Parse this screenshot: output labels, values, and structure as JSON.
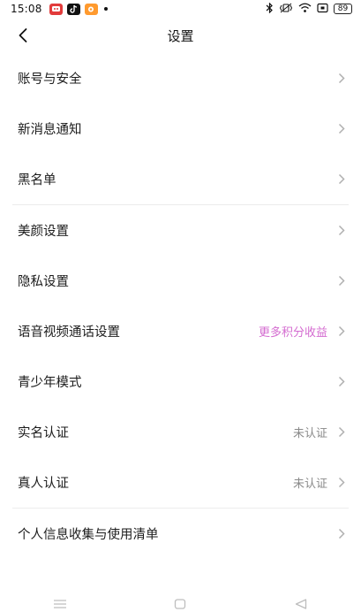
{
  "status_bar": {
    "time": "15:08",
    "battery": "89",
    "app_colors": {
      "red": "#e23b3b",
      "black": "#111111",
      "orange": "#ff9a2e"
    }
  },
  "header": {
    "title": "设置",
    "back_icon": "chevron-left-icon"
  },
  "groups": [
    [
      {
        "id": "account",
        "label": "账号与安全",
        "value": ""
      },
      {
        "id": "notify",
        "label": "新消息通知",
        "value": ""
      },
      {
        "id": "blacklist",
        "label": "黑名单",
        "value": ""
      }
    ],
    [
      {
        "id": "beauty",
        "label": "美颜设置",
        "value": ""
      },
      {
        "id": "privacy",
        "label": "隐私设置",
        "value": ""
      },
      {
        "id": "call",
        "label": "语音视频通话设置",
        "value": "更多积分收益",
        "value_color": "#d46bd0"
      },
      {
        "id": "teen",
        "label": "青少年模式",
        "value": ""
      },
      {
        "id": "realname",
        "label": "实名认证",
        "value": "未认证"
      },
      {
        "id": "realperson",
        "label": "真人认证",
        "value": "未认证"
      }
    ],
    [
      {
        "id": "personal-info",
        "label": "个人信息收集与使用清单",
        "value": ""
      }
    ]
  ]
}
